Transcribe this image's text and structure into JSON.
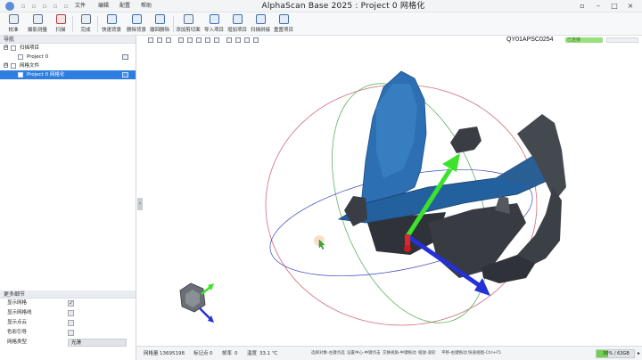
{
  "titlebar": {
    "title": "AlphaScan Base 2025 : Project 0 网格化",
    "menus": [
      "文件",
      "编辑",
      "配置",
      "帮助"
    ]
  },
  "toolbar": {
    "items": [
      {
        "label": "校准",
        "icon": "calibrate-icon"
      },
      {
        "label": "摄影测量",
        "icon": "photogrammetry-icon"
      },
      {
        "label": "扫描",
        "icon": "scan-icon"
      },
      {
        "label": "完成",
        "icon": "finish-icon"
      },
      {
        "label": "快速背景",
        "icon": "quick-background-icon"
      },
      {
        "label": "删除背景",
        "icon": "delete-background-icon"
      },
      {
        "label": "撤回删除",
        "icon": "undo-delete-icon"
      },
      {
        "label": "添加剪切面",
        "icon": "add-clip-plane-icon"
      },
      {
        "label": "导入项目",
        "icon": "import-project-icon"
      },
      {
        "label": "增加项目",
        "icon": "add-project-icon"
      },
      {
        "label": "扫描拼接",
        "icon": "scan-stitch-icon"
      },
      {
        "label": "重置项目",
        "icon": "reset-project-icon"
      }
    ]
  },
  "nav": {
    "header": "导航",
    "tree": [
      {
        "label": "扫描项目",
        "level": 0,
        "toggle": "⊟"
      },
      {
        "label": "Project 0",
        "level": 1,
        "toggle": ""
      },
      {
        "label": "网格文件",
        "level": 0,
        "toggle": "⊟"
      },
      {
        "label": "Project 0 网格化",
        "level": 1,
        "toggle": "",
        "selected": true
      }
    ]
  },
  "details": {
    "header": "更多细节",
    "options": [
      {
        "label": "显示网格",
        "checked": true
      },
      {
        "label": "显示网格线",
        "checked": false
      },
      {
        "label": "显示点云",
        "checked": false
      },
      {
        "label": "色彩引导",
        "checked": false
      }
    ],
    "mesh_type_label": "网格类型",
    "mesh_type_value": "光滑"
  },
  "viewport": {
    "device_id": "QY01APSC0254",
    "device_status": "已连接"
  },
  "status": {
    "mesh_count_label": "网格量",
    "mesh_count": "13695198",
    "marker_label": "标记点",
    "marker_count": "0",
    "fps_label": "帧率",
    "fps": "0",
    "temp_label": "温度",
    "temp": "33.1 ℃",
    "hints": [
      "选择对象-左键点选",
      "设置中心-中键点击",
      "交换视角-中键拖动",
      "缩放-滚轮",
      "平移-右键拖动",
      "快速视图-Ctrl+F5"
    ],
    "memory_text": "30% / 63GB",
    "memory_fraction": 0.3
  },
  "colors": {
    "selection": "#2d7ee0",
    "accent_green": "#6fcf4f",
    "mesh_blue": "#2c6fb2",
    "arrow_blue": "#2431d6",
    "arrow_green": "#3be32a",
    "handle_red": "#e0262a"
  }
}
